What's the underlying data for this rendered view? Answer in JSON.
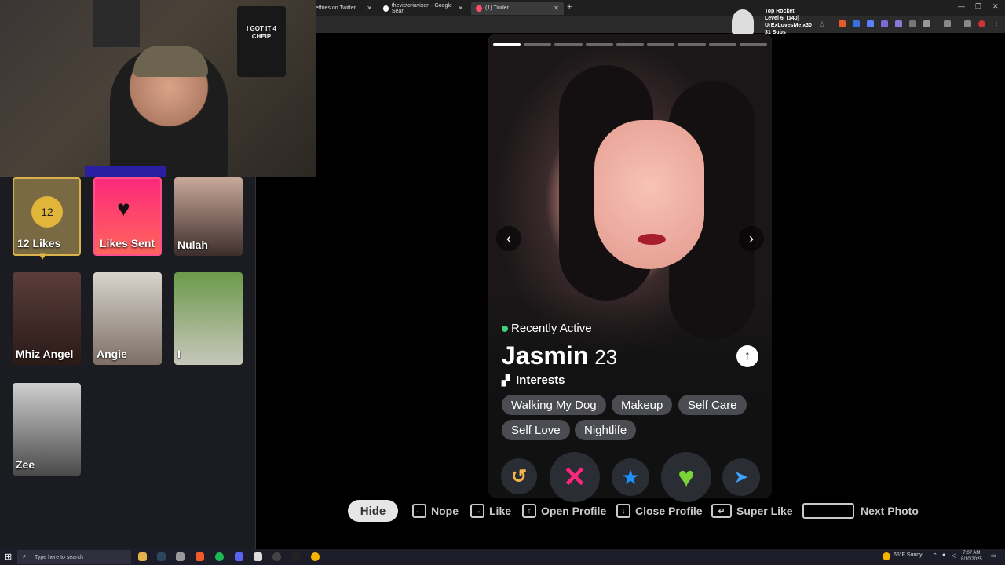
{
  "browser": {
    "tabs": [
      {
        "label": "effries on Twitter"
      },
      {
        "label": "thevictoriavixen - Google Sear"
      },
      {
        "label": "(1) Tinder"
      }
    ],
    "new_tab": "+",
    "close": "✕"
  },
  "webcam": {
    "shirt_text": "I GOT IT 4 CHEIP"
  },
  "stream_overlay": {
    "line1": "Top Rocket",
    "line2": "Level 6_(140)",
    "line3": "UrExLovesMe x30",
    "line4": "31 Subs"
  },
  "likes_panel": {
    "likes_count": "12",
    "likes_label": "12 Likes",
    "sent_label": "Likes Sent",
    "profiles": [
      {
        "name": "Nulah"
      },
      {
        "name": "Mhiz Angel"
      },
      {
        "name": "Angie"
      },
      {
        "name": "I"
      },
      {
        "name": "Zee"
      }
    ]
  },
  "profile": {
    "status": "Recently Active",
    "name": "Jasmin",
    "age": "23",
    "interests_heading": "Interests",
    "interests": [
      "Walking My Dog",
      "Makeup",
      "Self Care",
      "Self Love",
      "Nightlife"
    ],
    "photo_count": 9,
    "current_photo": 1
  },
  "actions": {
    "rewind": "rewind-icon",
    "nope": "x-icon",
    "superlike": "star-icon",
    "like": "heart-icon",
    "boost": "paper-plane-icon"
  },
  "shortcuts": {
    "hide": "Hide",
    "nope": "Nope",
    "like": "Like",
    "open_profile": "Open Profile",
    "close_profile": "Close Profile",
    "super_like": "Super Like",
    "next_photo": "Next Photo"
  },
  "taskbar": {
    "search_placeholder": "Type here to search",
    "weather": "65°F  Sunny",
    "time": "7:07 AM",
    "date": "8/10/2025"
  },
  "colors": {
    "nope": "#fd267d",
    "superlike": "#1e90ff",
    "like": "#7dd33a",
    "rewind": "#f5b748",
    "boost": "#3ea0ff",
    "active": "#3ad27a"
  }
}
